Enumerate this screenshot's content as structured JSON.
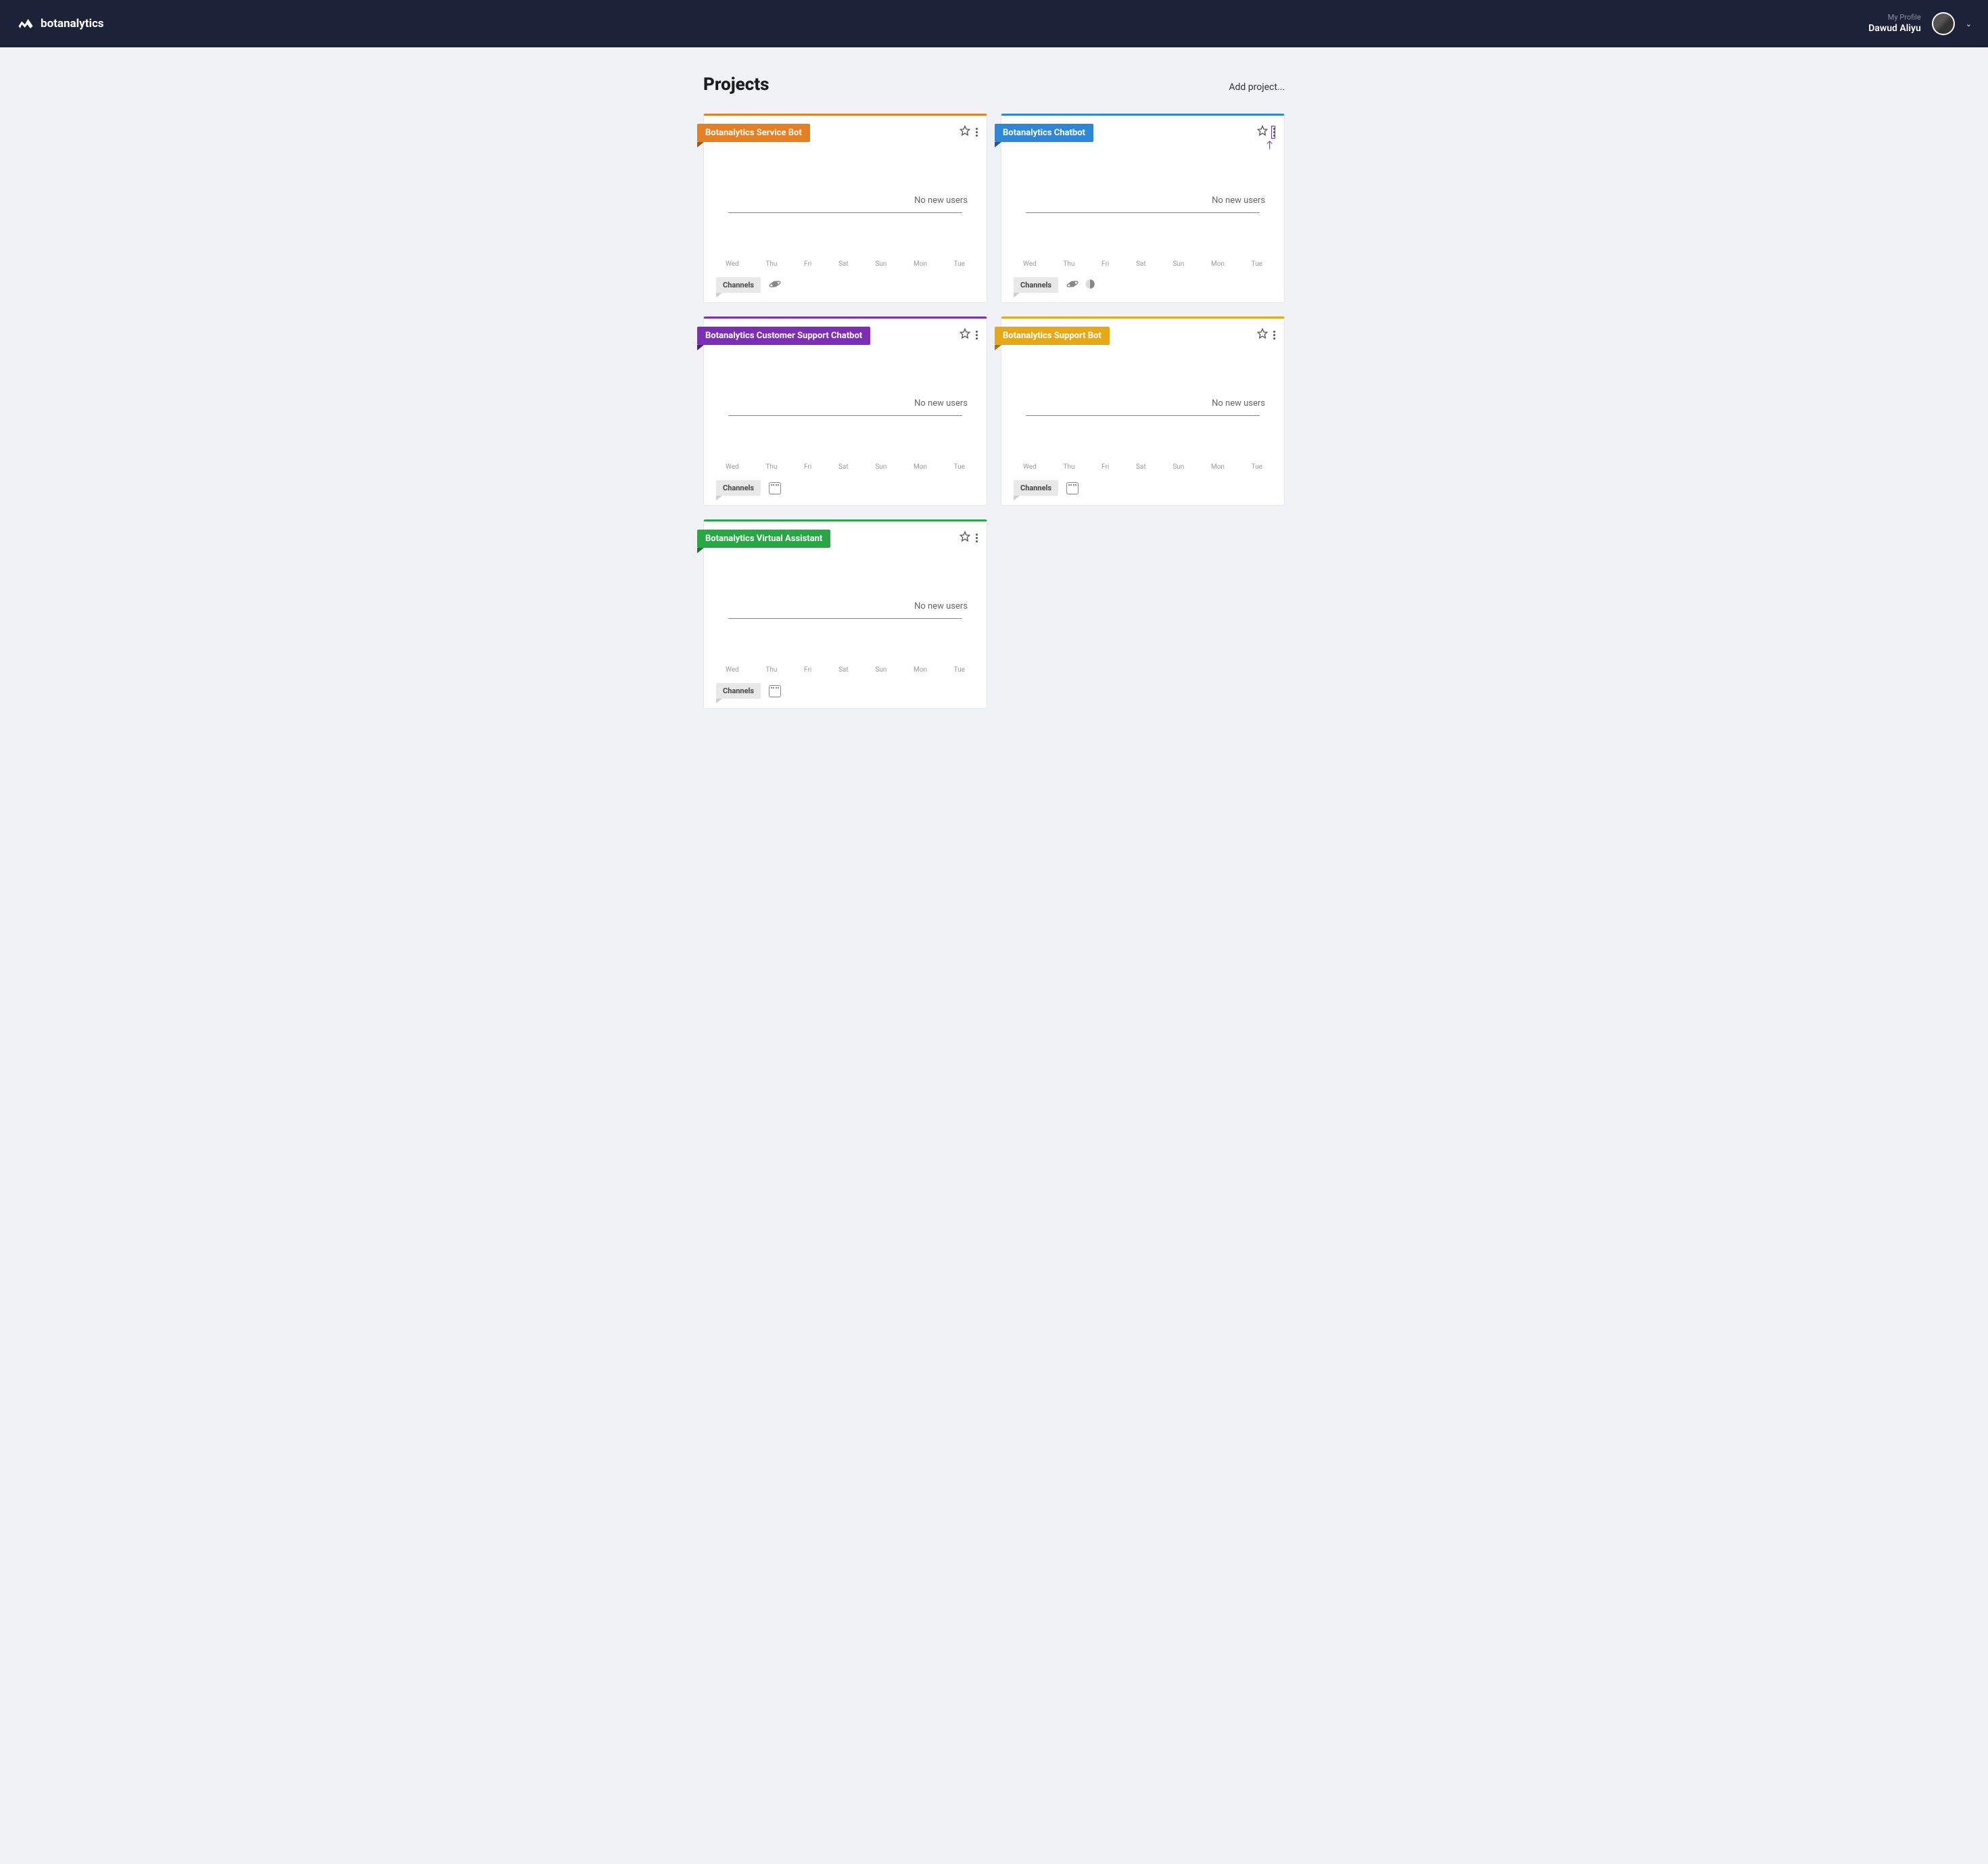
{
  "header": {
    "brand": "botanalytics",
    "profile_label": "My Profile",
    "profile_name": "Dawud Aliyu"
  },
  "page": {
    "title": "Projects",
    "add_label": "Add project..."
  },
  "common": {
    "no_users": "No new users",
    "channels": "Channels",
    "days": [
      "Wed",
      "Thu",
      "Fri",
      "Sat",
      "Sun",
      "Mon",
      "Tue"
    ]
  },
  "projects": [
    {
      "name": "Botanalytics Service Bot",
      "color": "orange",
      "channels": [
        "universal"
      ],
      "menu_highlight": false,
      "show_arrow": false
    },
    {
      "name": "Botanalytics Chatbot",
      "color": "blue",
      "channels": [
        "universal",
        "bixby"
      ],
      "menu_highlight": true,
      "show_arrow": true
    },
    {
      "name": "Botanalytics Customer Support Chatbot",
      "color": "purple",
      "channels": [
        "keyboard"
      ],
      "menu_highlight": false,
      "show_arrow": false
    },
    {
      "name": "Botanalytics Support Bot",
      "color": "gold",
      "channels": [
        "keyboard"
      ],
      "menu_highlight": false,
      "show_arrow": false
    },
    {
      "name": "Botanalytics Virtual Assistant",
      "color": "green",
      "channels": [
        "keyboard"
      ],
      "menu_highlight": false,
      "show_arrow": false
    }
  ]
}
